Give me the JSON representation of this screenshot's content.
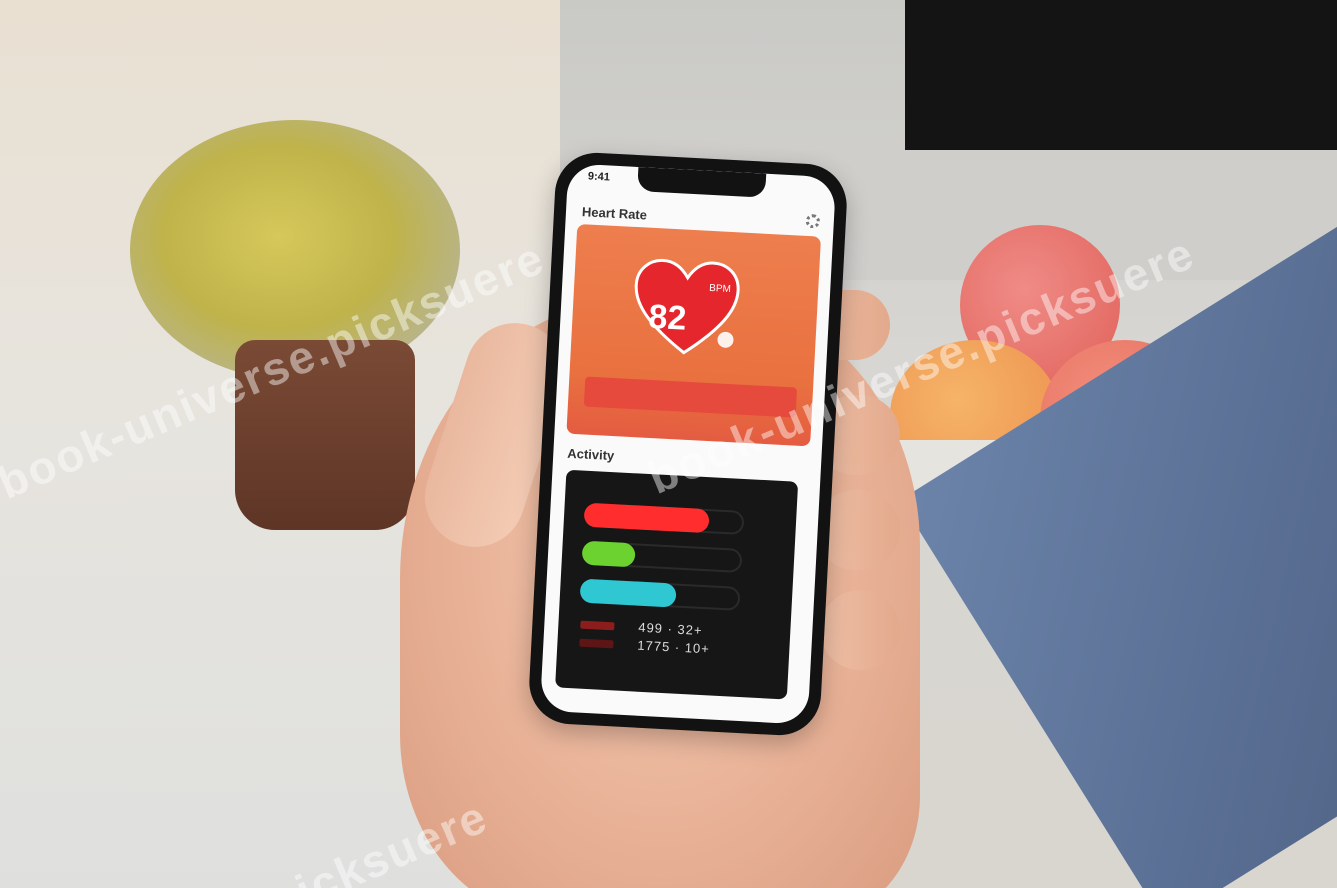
{
  "phone_screen": {
    "status_time": "9:41",
    "heart_rate_title": "Heart Rate",
    "bpm_value": "82",
    "bpm_unit": "BPM",
    "hr_bar_label": "",
    "activity_title": "Activity",
    "activity_stats": [
      "499 · 32+",
      "1775 · 10+"
    ],
    "ring_colors": [
      "#ff2d2d",
      "#6bd22f",
      "#2ec7d2"
    ],
    "ring_progress": [
      0.78,
      0.33,
      0.6
    ]
  },
  "watermark": {
    "text_left": "book-universe.picksuere",
    "text_right": "book-universe.picksuere",
    "text_bottom": "picksuere"
  }
}
